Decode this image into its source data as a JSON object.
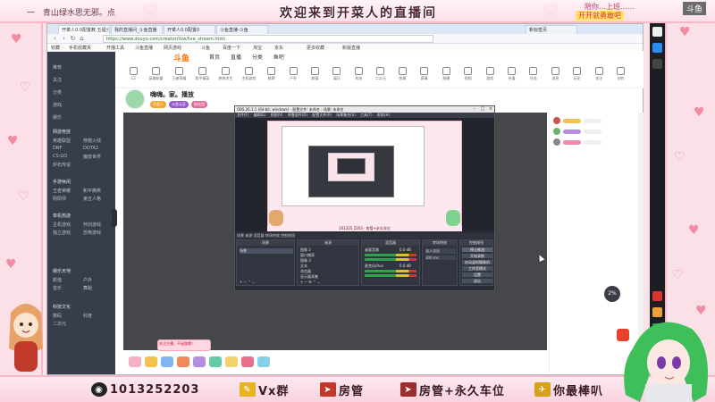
{
  "overlay": {
    "top_left_text": "一",
    "top_left_sub": "青山绿水思无邪。点",
    "title": "欢迎来到开菜人的直播间",
    "badge_top": "陪你…上班……",
    "badge_bottom": "开开就勇敢吧",
    "corner_logo": "斗鱼",
    "bottom": {
      "qq_label": "1013252203",
      "wx_label": "Vx群",
      "item3": "房管",
      "item4": "房管+永久车位",
      "item5": "你最棒叭"
    },
    "colors": {
      "frame": "#f4b9c9",
      "heart": "#f28ca5"
    }
  },
  "browser": {
    "tabs": [
      {
        "label": "开菜人0.0配置教.五福分开直播",
        "active": true
      },
      {
        "label": "我的直播间_斗鱼直播"
      },
      {
        "label": "开菜人0.0配置0"
      },
      {
        "label": "斗鱼直播-斗鱼"
      },
      {
        "label": "新标签页"
      }
    ],
    "address": "https://www.douyu.com/creator/live/live_stream.html",
    "bookmarks": [
      "收藏",
      "手机收藏夹",
      "开播工具",
      "斗鱼直播",
      "网页游戏",
      "斗鱼",
      "百度一下",
      "淘宝",
      "京东",
      "更多收藏",
      "新版直播"
    ],
    "site_logo": "斗鱼",
    "site_nav": [
      "首页",
      "直播",
      "分类",
      "鱼吧"
    ],
    "site_icons": [
      "12",
      "英雄联盟",
      "王者荣耀",
      "和平精英",
      "绝地求生",
      "主机游戏",
      "棋牌",
      "户外",
      "颜值",
      "娱乐",
      "科技",
      "二次元",
      "鱼塘",
      "赛事",
      "直播",
      "视频",
      "游戏",
      "充值",
      "任务",
      "消息",
      "历史",
      "关注",
      "创作"
    ],
    "sidebar": {
      "items": [
        "推荐",
        "关注",
        "分类",
        "游戏",
        "娱乐",
        "颜值"
      ],
      "sections": [
        {
          "title": "网游竞技",
          "items": [
            "英雄联盟",
            "穿越火线",
            "DNF",
            "DOTA2",
            "CS:GO",
            "魔兽世界",
            "炉石传说"
          ]
        },
        {
          "title": "手游休闲",
          "items": [
            "王者荣耀",
            "和平精英",
            "阴阳师",
            "第五人格"
          ]
        },
        {
          "title": "单机热游",
          "items": [
            "主机游戏",
            "怀旧游戏",
            "独立游戏",
            "恐怖游戏"
          ]
        },
        {
          "title": "娱乐天地",
          "items": [
            "颜值",
            "户外",
            "音乐",
            "舞蹈"
          ]
        },
        {
          "title": "科技文化",
          "items": [
            "数码",
            "科普",
            "二次元"
          ]
        }
      ]
    },
    "streamer": {
      "name": "嗨嗨。家。播放",
      "tags": [
        "开菜人",
        "斗鱼认证",
        "粉丝团"
      ]
    },
    "pop_bubble": "关注主播，不迷路哦！",
    "chat_percent": "2%"
  },
  "obs": {
    "title": "OBS 26.1.1 (64-bit, windows) - 配置文件: 未命名 - 场景: 未命名",
    "menu": [
      "文件(F)",
      "编辑(E)",
      "视图(V)",
      "停靠部件(D)",
      "配置文件(P)",
      "场景集合(S)",
      "工具(T)",
      "帮助(H)"
    ],
    "overlay_strip": "101325 2203 · 房管+永久车位",
    "bottom_header": "场景  来源  混音器  转场特效  控制按钮",
    "scenes_title": "场景",
    "sources_title": "来源",
    "sources": [
      "图像 2",
      "窗口捕获",
      "图像 3",
      "文本",
      "浏览器",
      "显示器采集"
    ],
    "scene_items": [
      "场景"
    ],
    "mixer_title": "混音器",
    "mixer": [
      {
        "name": "桌面音频",
        "level": "0.0 dB"
      },
      {
        "name": "麦克风/Aux",
        "level": "0.0 dB"
      }
    ],
    "transition_title": "转场特效",
    "transition_value": "淡入淡出",
    "transition_duration": "300 ms",
    "controls_title": "控制按钮",
    "controls": [
      "停止推流",
      "开始录制",
      "启动虚拟摄像机",
      "工作室模式",
      "设置",
      "退出"
    ]
  }
}
